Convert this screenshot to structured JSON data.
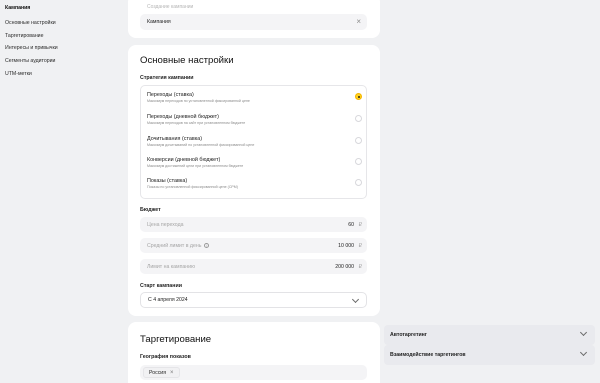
{
  "sidebar": {
    "items": [
      {
        "label": "Кампания"
      },
      {
        "label": "Основные настройки"
      },
      {
        "label": "Таргетирование"
      },
      {
        "label": "Интересы и привычки"
      },
      {
        "label": "Сегменты аудитории"
      },
      {
        "label": "UTM-метки"
      }
    ]
  },
  "top_card": {
    "field_label": "Создание кампании",
    "field_value": "Кампания"
  },
  "main_settings": {
    "title": "Основные настройки",
    "strategy_label": "Стратегия кампании",
    "options": [
      {
        "title": "Переходы (ставка)",
        "desc": "Максимум переходов по установленной фиксированной цене",
        "selected": true
      },
      {
        "title": "Переходы (дневной бюджет)",
        "desc": "Максимум переходов на сайт при установленном бюджете",
        "selected": false
      },
      {
        "title": "Дочитывания (ставка)",
        "desc": "Максимум дочитываний по установленной фиксированной цене",
        "selected": false
      },
      {
        "title": "Конверсии (дневной бюджет)",
        "desc": "Максимум достижений цели при установленном бюджете",
        "selected": false
      },
      {
        "title": "Показы (ставка)",
        "desc": "Показы по установленной фиксированной цене (CPM)",
        "selected": false
      }
    ],
    "budget_label": "Бюджет",
    "budget_fields": [
      {
        "placeholder": "Цена перехода",
        "value": "60",
        "currency": "₽",
        "info": false
      },
      {
        "placeholder": "Средний лимит в день",
        "value": "10 000",
        "currency": "₽",
        "info": true
      },
      {
        "placeholder": "Лимит на кампанию",
        "value": "200 000",
        "currency": "₽",
        "info": false
      }
    ],
    "start_label": "Старт кампании",
    "start_value": "С 4 апреля 2024"
  },
  "targeting": {
    "title": "Таргетирование",
    "geo_label": "География показов",
    "geo_chip": "Россия",
    "chip_remove": "×"
  },
  "right_panel": {
    "items": [
      {
        "label": "Автотаргетинг"
      },
      {
        "label": "Взаимодействие таргетингов"
      }
    ]
  },
  "colors": {
    "background": "#f0f1f3",
    "radio_selected": "#ffd21e"
  }
}
